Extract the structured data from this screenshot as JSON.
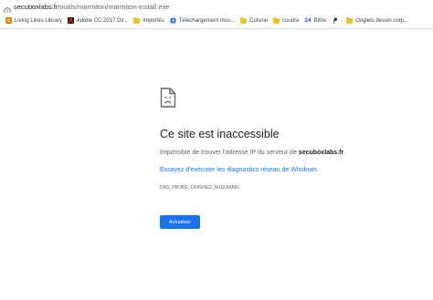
{
  "address_bar": {
    "domain": "secuboxlabs.fr",
    "path": "/outils/marmiton/marmiton-install.exe"
  },
  "bookmarks": [
    {
      "label": "Living Lines Library",
      "icon": "blogger-icon",
      "color": "#f57d00"
    },
    {
      "label": "Adobe CC 2017 Dir...",
      "icon": "adobe-icon",
      "color": "#3a0a0a"
    },
    {
      "label": "Importés",
      "icon": "folder-icon",
      "color": "#f2c12e"
    },
    {
      "label": "Téléchargement mus...",
      "icon": "globe-icon",
      "color": "#1a73e8"
    },
    {
      "label": "Cuisine",
      "icon": "folder-icon",
      "color": "#f2c12e"
    },
    {
      "label": "coudre",
      "icon": "folder-icon",
      "color": "#f2c12e"
    },
    {
      "label": "Bitrix",
      "icon": "bitrix-icon",
      "color": "#2fc6f6",
      "icon_text": "24"
    },
    {
      "label": "",
      "icon": "paypal-icon",
      "color": "#003087"
    },
    {
      "label": "Onglets dessin corp...",
      "icon": "folder-icon",
      "color": "#f2c12e"
    }
  ],
  "error_page": {
    "title": "Ce site est inaccessible",
    "message_prefix": "Impossible de trouver l'adresse IP du serveur de ",
    "message_domain": "secuboxlabs.fr",
    "message_suffix": ".",
    "suggestion": "Essayez d'exécuter les diagnostics réseau de Windows.",
    "error_code": "DNS_PROBE_FINISHED_NXDOMAIN",
    "reload_label": "Actualiser"
  },
  "colors": {
    "accent": "#1a73e8",
    "text_primary": "#202124",
    "text_secondary": "#5f6368"
  }
}
